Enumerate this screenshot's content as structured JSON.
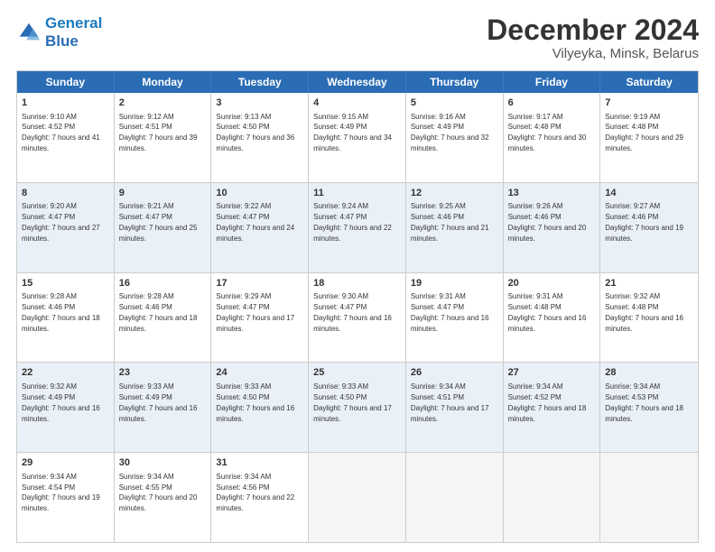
{
  "header": {
    "logo_line1": "General",
    "logo_line2": "Blue",
    "title": "December 2024",
    "subtitle": "Vilyeyka, Minsk, Belarus"
  },
  "calendar": {
    "days_of_week": [
      "Sunday",
      "Monday",
      "Tuesday",
      "Wednesday",
      "Thursday",
      "Friday",
      "Saturday"
    ],
    "weeks": [
      [
        {
          "day": "",
          "empty": true
        },
        {
          "day": "",
          "empty": true
        },
        {
          "day": "",
          "empty": true
        },
        {
          "day": "",
          "empty": true
        },
        {
          "day": "",
          "empty": true
        },
        {
          "day": "",
          "empty": true
        },
        {
          "day": "",
          "empty": true
        }
      ],
      [
        {
          "day": "1",
          "sunrise": "Sunrise: 9:10 AM",
          "sunset": "Sunset: 4:52 PM",
          "daylight": "Daylight: 7 hours and 41 minutes."
        },
        {
          "day": "2",
          "sunrise": "Sunrise: 9:12 AM",
          "sunset": "Sunset: 4:51 PM",
          "daylight": "Daylight: 7 hours and 39 minutes."
        },
        {
          "day": "3",
          "sunrise": "Sunrise: 9:13 AM",
          "sunset": "Sunset: 4:50 PM",
          "daylight": "Daylight: 7 hours and 36 minutes."
        },
        {
          "day": "4",
          "sunrise": "Sunrise: 9:15 AM",
          "sunset": "Sunset: 4:49 PM",
          "daylight": "Daylight: 7 hours and 34 minutes."
        },
        {
          "day": "5",
          "sunrise": "Sunrise: 9:16 AM",
          "sunset": "Sunset: 4:49 PM",
          "daylight": "Daylight: 7 hours and 32 minutes."
        },
        {
          "day": "6",
          "sunrise": "Sunrise: 9:17 AM",
          "sunset": "Sunset: 4:48 PM",
          "daylight": "Daylight: 7 hours and 30 minutes."
        },
        {
          "day": "7",
          "sunrise": "Sunrise: 9:19 AM",
          "sunset": "Sunset: 4:48 PM",
          "daylight": "Daylight: 7 hours and 29 minutes."
        }
      ],
      [
        {
          "day": "8",
          "sunrise": "Sunrise: 9:20 AM",
          "sunset": "Sunset: 4:47 PM",
          "daylight": "Daylight: 7 hours and 27 minutes."
        },
        {
          "day": "9",
          "sunrise": "Sunrise: 9:21 AM",
          "sunset": "Sunset: 4:47 PM",
          "daylight": "Daylight: 7 hours and 25 minutes."
        },
        {
          "day": "10",
          "sunrise": "Sunrise: 9:22 AM",
          "sunset": "Sunset: 4:47 PM",
          "daylight": "Daylight: 7 hours and 24 minutes."
        },
        {
          "day": "11",
          "sunrise": "Sunrise: 9:24 AM",
          "sunset": "Sunset: 4:47 PM",
          "daylight": "Daylight: 7 hours and 22 minutes."
        },
        {
          "day": "12",
          "sunrise": "Sunrise: 9:25 AM",
          "sunset": "Sunset: 4:46 PM",
          "daylight": "Daylight: 7 hours and 21 minutes."
        },
        {
          "day": "13",
          "sunrise": "Sunrise: 9:26 AM",
          "sunset": "Sunset: 4:46 PM",
          "daylight": "Daylight: 7 hours and 20 minutes."
        },
        {
          "day": "14",
          "sunrise": "Sunrise: 9:27 AM",
          "sunset": "Sunset: 4:46 PM",
          "daylight": "Daylight: 7 hours and 19 minutes."
        }
      ],
      [
        {
          "day": "15",
          "sunrise": "Sunrise: 9:28 AM",
          "sunset": "Sunset: 4:46 PM",
          "daylight": "Daylight: 7 hours and 18 minutes."
        },
        {
          "day": "16",
          "sunrise": "Sunrise: 9:28 AM",
          "sunset": "Sunset: 4:46 PM",
          "daylight": "Daylight: 7 hours and 18 minutes."
        },
        {
          "day": "17",
          "sunrise": "Sunrise: 9:29 AM",
          "sunset": "Sunset: 4:47 PM",
          "daylight": "Daylight: 7 hours and 17 minutes."
        },
        {
          "day": "18",
          "sunrise": "Sunrise: 9:30 AM",
          "sunset": "Sunset: 4:47 PM",
          "daylight": "Daylight: 7 hours and 16 minutes."
        },
        {
          "day": "19",
          "sunrise": "Sunrise: 9:31 AM",
          "sunset": "Sunset: 4:47 PM",
          "daylight": "Daylight: 7 hours and 16 minutes."
        },
        {
          "day": "20",
          "sunrise": "Sunrise: 9:31 AM",
          "sunset": "Sunset: 4:48 PM",
          "daylight": "Daylight: 7 hours and 16 minutes."
        },
        {
          "day": "21",
          "sunrise": "Sunrise: 9:32 AM",
          "sunset": "Sunset: 4:48 PM",
          "daylight": "Daylight: 7 hours and 16 minutes."
        }
      ],
      [
        {
          "day": "22",
          "sunrise": "Sunrise: 9:32 AM",
          "sunset": "Sunset: 4:49 PM",
          "daylight": "Daylight: 7 hours and 16 minutes."
        },
        {
          "day": "23",
          "sunrise": "Sunrise: 9:33 AM",
          "sunset": "Sunset: 4:49 PM",
          "daylight": "Daylight: 7 hours and 16 minutes."
        },
        {
          "day": "24",
          "sunrise": "Sunrise: 9:33 AM",
          "sunset": "Sunset: 4:50 PM",
          "daylight": "Daylight: 7 hours and 16 minutes."
        },
        {
          "day": "25",
          "sunrise": "Sunrise: 9:33 AM",
          "sunset": "Sunset: 4:50 PM",
          "daylight": "Daylight: 7 hours and 17 minutes."
        },
        {
          "day": "26",
          "sunrise": "Sunrise: 9:34 AM",
          "sunset": "Sunset: 4:51 PM",
          "daylight": "Daylight: 7 hours and 17 minutes."
        },
        {
          "day": "27",
          "sunrise": "Sunrise: 9:34 AM",
          "sunset": "Sunset: 4:52 PM",
          "daylight": "Daylight: 7 hours and 18 minutes."
        },
        {
          "day": "28",
          "sunrise": "Sunrise: 9:34 AM",
          "sunset": "Sunset: 4:53 PM",
          "daylight": "Daylight: 7 hours and 18 minutes."
        }
      ],
      [
        {
          "day": "29",
          "sunrise": "Sunrise: 9:34 AM",
          "sunset": "Sunset: 4:54 PM",
          "daylight": "Daylight: 7 hours and 19 minutes."
        },
        {
          "day": "30",
          "sunrise": "Sunrise: 9:34 AM",
          "sunset": "Sunset: 4:55 PM",
          "daylight": "Daylight: 7 hours and 20 minutes."
        },
        {
          "day": "31",
          "sunrise": "Sunrise: 9:34 AM",
          "sunset": "Sunset: 4:56 PM",
          "daylight": "Daylight: 7 hours and 22 minutes."
        },
        {
          "day": "",
          "empty": true
        },
        {
          "day": "",
          "empty": true
        },
        {
          "day": "",
          "empty": true
        },
        {
          "day": "",
          "empty": true
        }
      ]
    ]
  }
}
